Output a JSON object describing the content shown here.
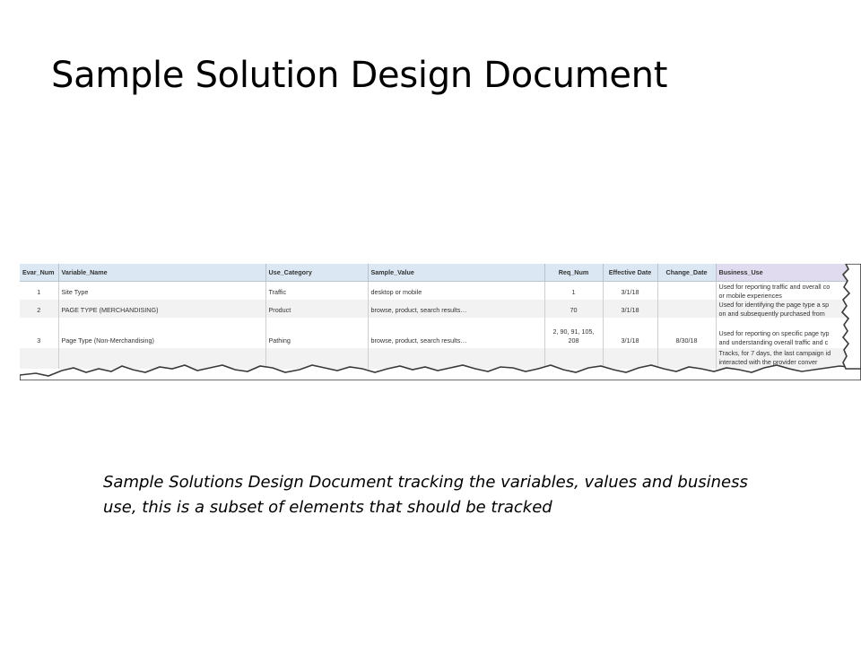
{
  "slide": {
    "title": "Sample Solution Design Document",
    "caption": "Sample Solutions Design Document tracking the variables, values and business use, this is a subset of elements that should be tracked"
  },
  "sheet": {
    "headers": [
      "Evar_Num",
      "Variable_Name",
      "Use_Category",
      "Sample_Value",
      "Req_Num",
      "Effective Date",
      "Change_Date",
      "Business_Use"
    ],
    "header_colors": {
      "blue": "#dbe7f2",
      "lavender": "#e0dbee",
      "row_stripe": "#f2f2f2"
    },
    "rows": [
      {
        "evar_num": "1",
        "variable_name": "Site Type",
        "use_category": "Traffic",
        "sample_value": "desktop or mobile",
        "req_num": "1",
        "effective_date": "3/1/18",
        "change_date": "",
        "business_use": [
          "Used for reporting traffic and overall co",
          "or mobile experiences"
        ]
      },
      {
        "evar_num": "2",
        "variable_name": "PAGE TYPE (MERCHANDISING)",
        "use_category": "Product",
        "sample_value": "browse, product, search results…",
        "req_num": "70",
        "effective_date": "3/1/18",
        "change_date": "",
        "business_use": [
          "Used for identifying the page type a sp",
          "on and subsequently purchased from"
        ]
      },
      {
        "evar_num": "3",
        "variable_name": "Page Type (Non-Merchandising)",
        "use_category": "Pathing",
        "sample_value": "browse, product, search results…",
        "req_num": "2, 90, 91, 105, 208",
        "effective_date": "3/1/18",
        "change_date": "8/30/18",
        "business_use": [
          "Used for reporting on specific page typ",
          "and understanding overall traffic and c"
        ]
      },
      {
        "evar_num": "",
        "variable_name": "",
        "use_category": "",
        "sample_value": "",
        "req_num": "",
        "effective_date": "",
        "change_date": "",
        "business_use": [
          "Tracks, for 7 days, the last campaign id",
          "interacted with the provider conver"
        ]
      }
    ]
  }
}
